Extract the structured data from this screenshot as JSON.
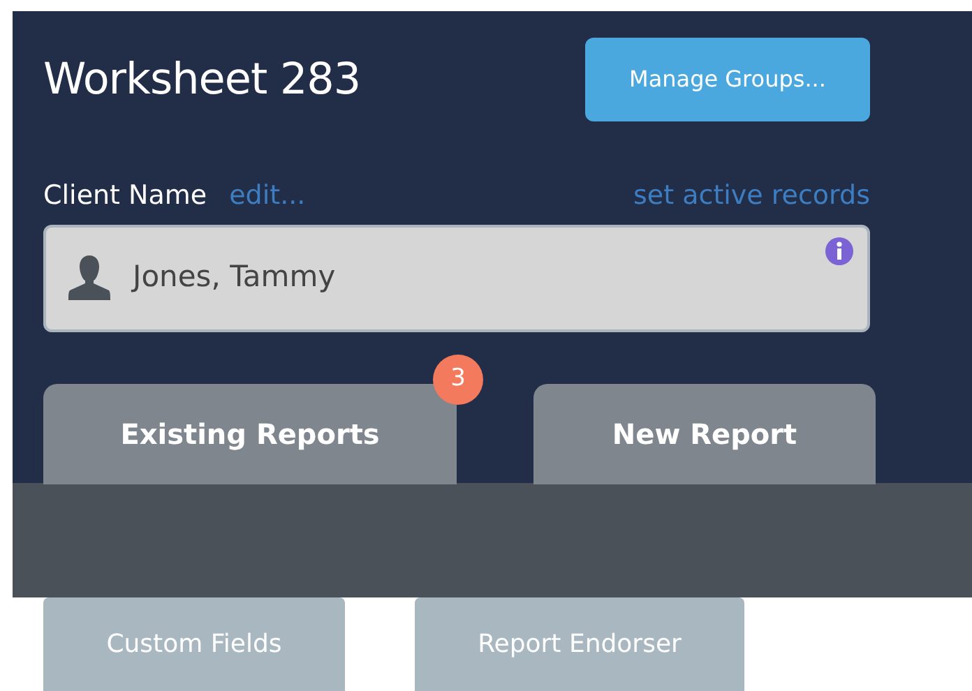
{
  "header": {
    "title": "Worksheet 283",
    "manage_button": "Manage Groups..."
  },
  "client": {
    "label": "Client Name",
    "edit_link": "edit...",
    "records_link": "set active records",
    "value": "Jones, Tammy"
  },
  "tabs": [
    {
      "label": "Existing Reports",
      "badge": "3"
    },
    {
      "label": "New Report"
    }
  ],
  "buttons": [
    "Custom Fields",
    "Report Endorser"
  ]
}
